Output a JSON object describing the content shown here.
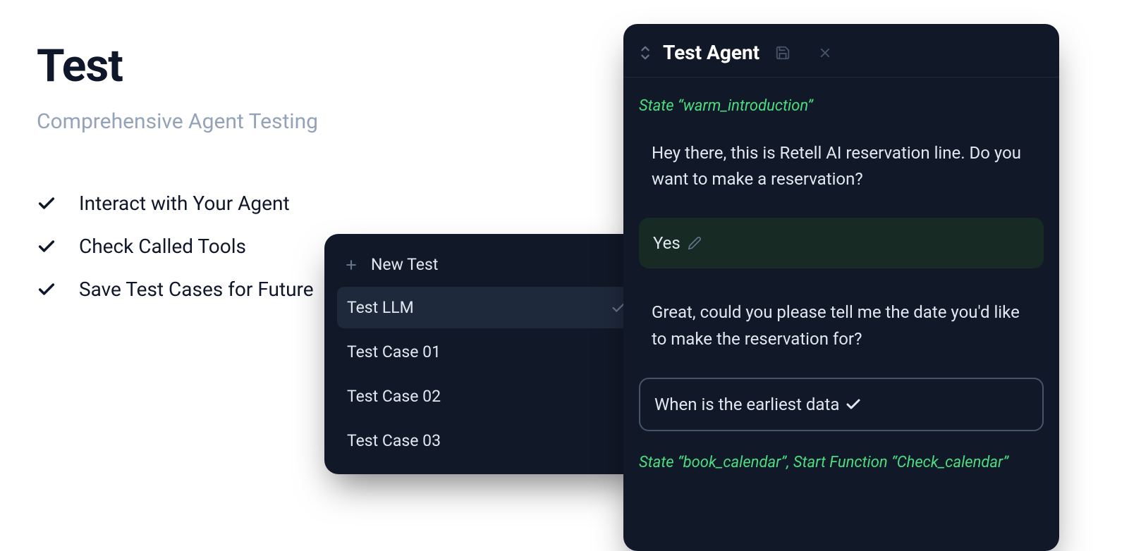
{
  "page": {
    "title": "Test",
    "subtitle": "Comprehensive Agent Testing"
  },
  "bullets": [
    "Interact with Your Agent",
    "Check Called Tools",
    "Save Test Cases for Future"
  ],
  "testSelector": {
    "newTestLabel": "New Test",
    "items": [
      {
        "label": "Test LLM",
        "selected": true
      },
      {
        "label": "Test Case 01",
        "selected": false
      },
      {
        "label": "Test Case 02",
        "selected": false
      },
      {
        "label": "Test Case 03",
        "selected": false
      }
    ]
  },
  "agentPanel": {
    "title": "Test Agent",
    "state1": "State “warm_introduction”",
    "message1": "Hey there, this is Retell AI reservation line. Do you want to make a reservation?",
    "userReply": "Yes",
    "message2": "Great, could you please tell me the date you'd like to make the reservation for?",
    "inputText": "When is the earliest data",
    "state2": "State “book_calendar”, Start Function “Check_calendar”"
  }
}
